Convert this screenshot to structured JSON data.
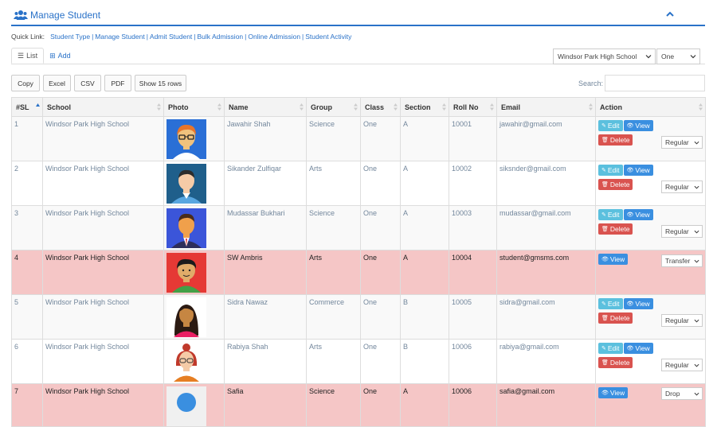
{
  "header": {
    "title": "Manage Student"
  },
  "quick_links": {
    "label": "Quick Link:",
    "links": [
      "Student Type",
      "Manage Student",
      "Admit Student",
      "Bulk Admission",
      "Online Admission",
      "Student Activity"
    ]
  },
  "tabs": {
    "list": "List",
    "add": "Add"
  },
  "filters": {
    "school": "Windsor Park High School",
    "class": "One"
  },
  "buttons": {
    "copy": "Copy",
    "excel": "Excel",
    "csv": "CSV",
    "pdf": "PDF",
    "show_rows": "Show 15 rows"
  },
  "search": {
    "label": "Search:",
    "value": ""
  },
  "columns": [
    "#SL",
    "School",
    "Photo",
    "Name",
    "Group",
    "Class",
    "Section",
    "Roll No",
    "Email",
    "Action"
  ],
  "actions": {
    "edit": "Edit",
    "view": "View",
    "delete": "Delete"
  },
  "rows": [
    {
      "sl": "1",
      "school": "Windsor Park High School",
      "name": "Jawahir Shah",
      "group": "Science",
      "class": "One",
      "section": "A",
      "roll": "10001",
      "email": "jawahir@gmail.com",
      "status": "Regular",
      "highlight": false,
      "avatar": "glasses-boy"
    },
    {
      "sl": "2",
      "school": "Windsor Park High School",
      "name": "Sikander Zulfiqar",
      "group": "Arts",
      "class": "One",
      "section": "A",
      "roll": "10002",
      "email": "siksnder@gmail.com",
      "status": "Regular",
      "highlight": false,
      "avatar": "man-blue"
    },
    {
      "sl": "3",
      "school": "Windsor Park High School",
      "name": "Mudassar Bukhari",
      "group": "Science",
      "class": "One",
      "section": "A",
      "roll": "10003",
      "email": "mudassar@gmail.com",
      "status": "Regular",
      "highlight": false,
      "avatar": "man-suit"
    },
    {
      "sl": "4",
      "school": "Windsor Park High School",
      "name": "SW Ambris",
      "group": "Arts",
      "class": "One",
      "section": "A",
      "roll": "10004",
      "email": "student@gmsms.com",
      "status": "Transfer",
      "highlight": true,
      "avatar": "boy-green"
    },
    {
      "sl": "5",
      "school": "Windsor Park High School",
      "name": "Sidra Nawaz",
      "group": "Commerce",
      "class": "One",
      "section": "B",
      "roll": "10005",
      "email": "sidra@gmail.com",
      "status": "Regular",
      "highlight": false,
      "avatar": "girl-longhair"
    },
    {
      "sl": "6",
      "school": "Windsor Park High School",
      "name": "Rabiya Shah",
      "group": "Arts",
      "class": "One",
      "section": "B",
      "roll": "10006",
      "email": "rabiya@gmail.com",
      "status": "Regular",
      "highlight": false,
      "avatar": "girl-bun"
    },
    {
      "sl": "7",
      "school": "Windsor Park High School",
      "name": "Safia",
      "group": "Science",
      "class": "One",
      "section": "A",
      "roll": "10006",
      "email": "safia@gmail.com",
      "status": "Drop",
      "highlight": true,
      "avatar": "placeholder"
    }
  ],
  "colors": {
    "accent": "#2a72c8",
    "alert_row": "#f5c6c6",
    "edit": "#5bc0de",
    "view": "#3a8fe0",
    "delete": "#d9534f"
  }
}
